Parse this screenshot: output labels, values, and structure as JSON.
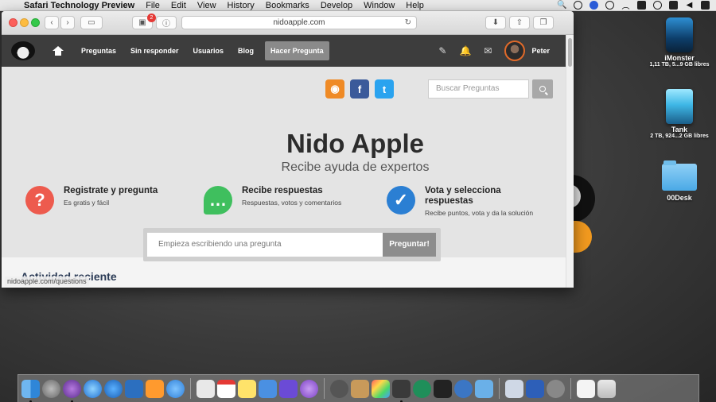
{
  "menubar": {
    "app_name": "Safari Technology Preview",
    "menus": [
      "File",
      "Edit",
      "View",
      "History",
      "Bookmarks",
      "Develop",
      "Window",
      "Help"
    ]
  },
  "browser": {
    "url": "nidoapple.com",
    "notification_count": "2",
    "status_url": "nidoapple.com/questions"
  },
  "site_nav": {
    "links": [
      "Preguntas",
      "Sin responder",
      "Usuarios",
      "Blog"
    ],
    "ask_button": "Hacer Pregunta",
    "username": "Peter"
  },
  "search": {
    "placeholder": "Buscar Preguntas"
  },
  "hero": {
    "title": "Nido Apple",
    "subtitle": "Recibe ayuda de expertos"
  },
  "features": [
    {
      "title": "Registrate y pregunta",
      "desc": "Es gratis y fácil",
      "icon": "question-icon"
    },
    {
      "title": "Recibe respuestas",
      "desc": "Respuestas, votos y comentarios",
      "icon": "chat-icon"
    },
    {
      "title": "Vota y selecciona respuestas",
      "desc": "Recibe puntos, vota y da la solución",
      "icon": "check-icon"
    }
  ],
  "ask": {
    "placeholder": "Empieza escribiendo una pregunta",
    "button": "Preguntar!"
  },
  "recent_heading": "Actividad reciente",
  "desktop": [
    {
      "name": "iMonster",
      "info": "1,11 TB, 5...9 GB libres"
    },
    {
      "name": "Tank",
      "info": "2 TB, 924...2 GB libres"
    },
    {
      "name": "00Desk",
      "info": ""
    }
  ],
  "colors": {
    "nav_bg": "#3d3d3d",
    "rss": "#ef8a25",
    "facebook": "#3b5a9a",
    "twitter": "#2aa3ef",
    "feature_red": "#ed5b4e",
    "feature_green": "#3fbf5e",
    "feature_blue": "#2b7fd3"
  }
}
